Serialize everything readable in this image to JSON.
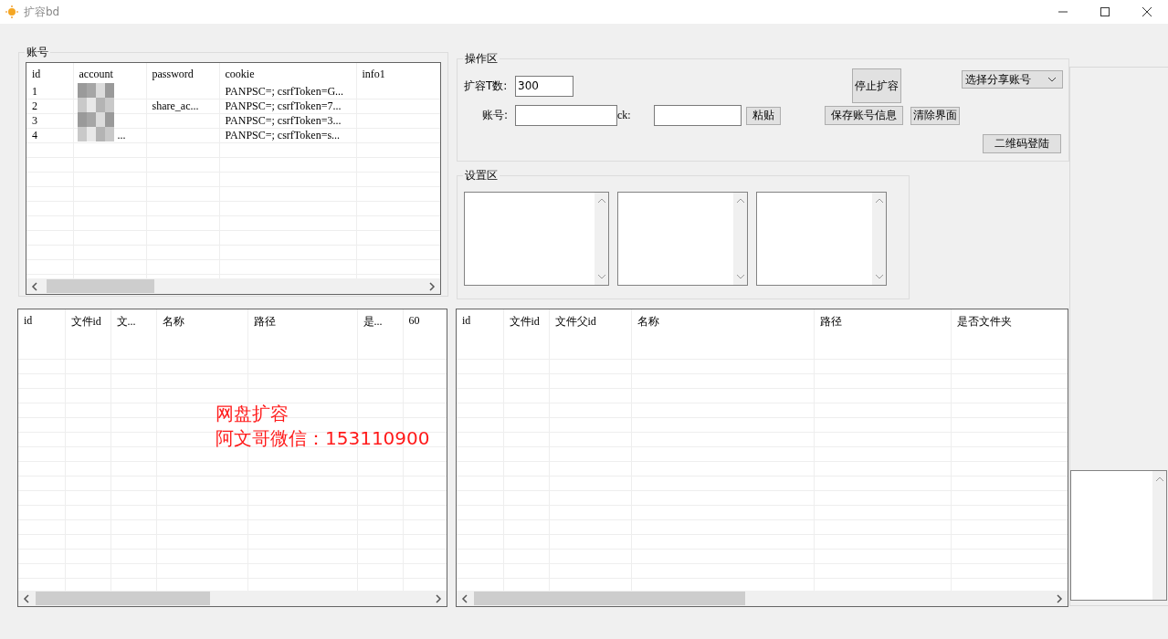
{
  "window": {
    "title": "扩容bd"
  },
  "account_group": {
    "title": "账号",
    "columns": [
      "id",
      "account",
      "password",
      "cookie",
      "info1"
    ],
    "rows": [
      {
        "id": "1",
        "cookie": "PANPSC=; csrfToken=G..."
      },
      {
        "id": "2",
        "password": "share_ac...",
        "cookie": "PANPSC=; csrfToken=7..."
      },
      {
        "id": "3",
        "cookie": "PANPSC=; csrfToken=3..."
      },
      {
        "id": "4",
        "account": "...",
        "cookie": "PANPSC=; csrfToken=s..."
      }
    ]
  },
  "operation_group": {
    "title": "操作区",
    "expand_label": "扩容T数:",
    "expand_value": "300",
    "account_label": "账号:",
    "ck_label": "ck:",
    "paste_button": "粘贴",
    "stop_button": "停止扩容",
    "save_button": "保存账号信息",
    "clear_button": "清除界面",
    "share_account_dropdown": "选择分享账号",
    "qr_login_button": "二维码登陆"
  },
  "settings_group": {
    "title": "设置区"
  },
  "left_file_table": {
    "columns": [
      "id",
      "文件id",
      "文...",
      "名称",
      "路径",
      "是...",
      "60"
    ]
  },
  "right_file_table": {
    "columns": [
      "id",
      "文件id",
      "文件父id",
      "名称",
      "路径",
      "是否文件夹"
    ]
  },
  "overlay_caption": [
    "网盘扩容",
    "阿文哥微信：153110900"
  ]
}
